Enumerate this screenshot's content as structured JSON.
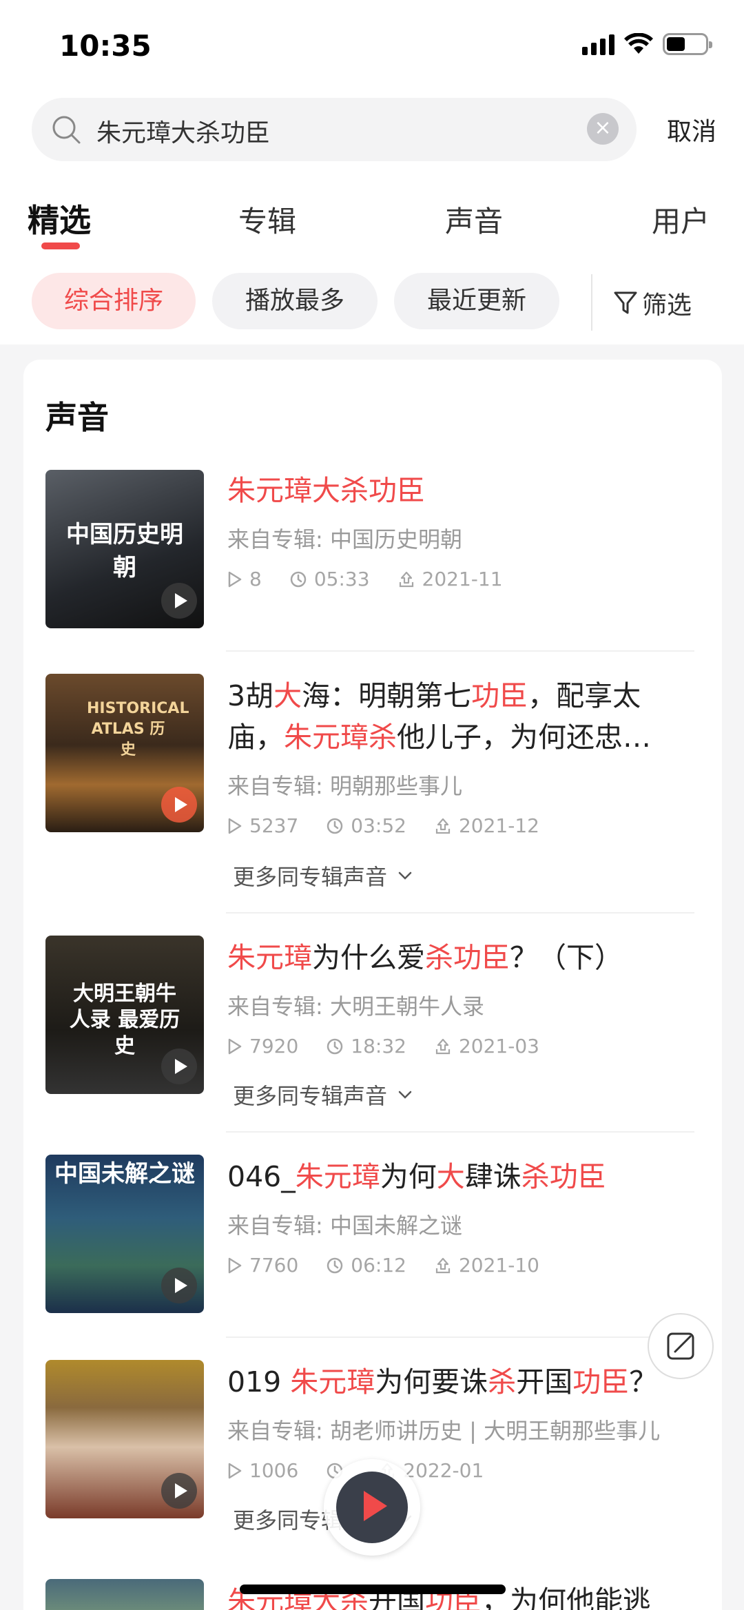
{
  "status": {
    "time": "10:35"
  },
  "search": {
    "query": "朱元璋大杀功臣",
    "cancel": "取消"
  },
  "tabs": [
    {
      "label": "精选",
      "active": true
    },
    {
      "label": "专辑"
    },
    {
      "label": "声音"
    },
    {
      "label": "用户"
    }
  ],
  "filters": {
    "sort_options": [
      "综合排序",
      "播放最多",
      "最近更新"
    ],
    "active": "综合排序",
    "filter_label": "筛选"
  },
  "section_title": "声音",
  "more_label": "更多同专辑声音",
  "items": [
    {
      "cover_text": "中国历史明朝",
      "title_parts": [
        {
          "t": "朱元璋大杀功臣",
          "h": true
        }
      ],
      "album": "来自专辑: 中国历史明朝",
      "plays": "8",
      "duration": "05:33",
      "date": "2021-11",
      "has_more": false
    },
    {
      "cover_text": "HISTORICAL ATLAS 历史",
      "title_parts": [
        {
          "t": "3胡",
          "h": false
        },
        {
          "t": "大",
          "h": true
        },
        {
          "t": "海：明朝第七",
          "h": false
        },
        {
          "t": "功臣",
          "h": true
        },
        {
          "t": "，配享太庙，",
          "h": false
        },
        {
          "t": "朱元璋杀",
          "h": true
        },
        {
          "t": "他儿子，为何还忠…",
          "h": false
        }
      ],
      "album": "来自专辑: 明朝那些事儿",
      "plays": "5237",
      "duration": "03:52",
      "date": "2021-12",
      "has_more": true
    },
    {
      "cover_text": "大明王朝牛人录 最爱历史",
      "title_parts": [
        {
          "t": "朱元璋",
          "h": true
        },
        {
          "t": "为什么爱",
          "h": false
        },
        {
          "t": "杀功臣",
          "h": true
        },
        {
          "t": "？（下）",
          "h": false
        }
      ],
      "album": "来自专辑: 大明王朝牛人录",
      "plays": "7920",
      "duration": "18:32",
      "date": "2021-03",
      "has_more": true
    },
    {
      "cover_text": "中国未解之谜",
      "title_parts": [
        {
          "t": "046_",
          "h": false
        },
        {
          "t": "朱元璋",
          "h": true
        },
        {
          "t": "为何",
          "h": false
        },
        {
          "t": "大",
          "h": true
        },
        {
          "t": "肆诛",
          "h": false
        },
        {
          "t": "杀功臣",
          "h": true
        }
      ],
      "album": "来自专辑: 中国未解之谜",
      "plays": "7760",
      "duration": "06:12",
      "date": "2021-10",
      "has_more": false
    },
    {
      "cover_text": "",
      "title_parts": [
        {
          "t": "019 ",
          "h": false
        },
        {
          "t": "朱元璋",
          "h": true
        },
        {
          "t": "为何要诛",
          "h": false
        },
        {
          "t": "杀",
          "h": true
        },
        {
          "t": "开国",
          "h": false
        },
        {
          "t": "功臣",
          "h": true
        },
        {
          "t": "？",
          "h": false
        }
      ],
      "album": "来自专辑: 胡老师讲历史 | 大明王朝那些事儿",
      "plays": "1006",
      "duration": "",
      "date": "2022-01",
      "has_more": true
    },
    {
      "cover_text": "",
      "title_parts": [
        {
          "t": "朱元璋大杀",
          "h": true
        },
        {
          "t": "开国",
          "h": false
        },
        {
          "t": "功臣",
          "h": true
        },
        {
          "t": "，为何他能逃",
          "h": false
        }
      ],
      "album": "",
      "plays": "",
      "duration": "",
      "date": "",
      "has_more": false
    }
  ]
}
